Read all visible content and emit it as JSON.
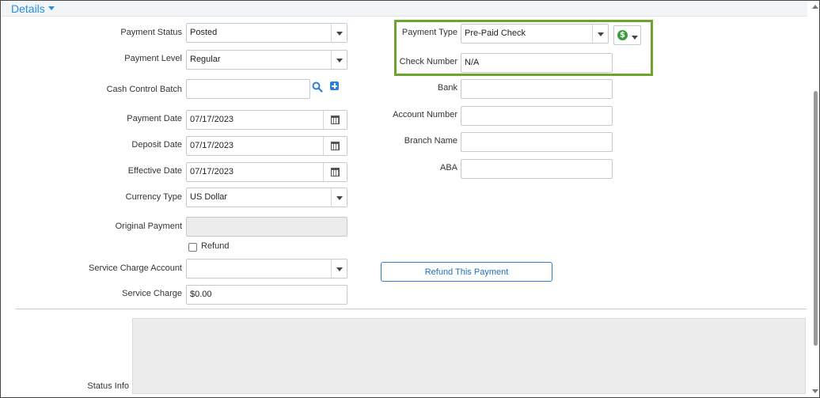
{
  "header": {
    "title": "Details"
  },
  "left": {
    "payment_status": {
      "label": "Payment Status",
      "value": "Posted"
    },
    "payment_level": {
      "label": "Payment Level",
      "value": "Regular"
    },
    "cash_control_batch": {
      "label": "Cash Control Batch",
      "value": ""
    },
    "payment_date": {
      "label": "Payment Date",
      "value": "07/17/2023"
    },
    "deposit_date": {
      "label": "Deposit Date",
      "value": "07/17/2023"
    },
    "effective_date": {
      "label": "Effective Date",
      "value": "07/17/2023"
    },
    "currency_type": {
      "label": "Currency Type",
      "value": "US Dollar"
    },
    "original_payment": {
      "label": "Original Payment",
      "value": ""
    },
    "refund": {
      "label": "Refund",
      "checked": false
    },
    "service_charge_account": {
      "label": "Service Charge Account",
      "value": ""
    },
    "service_charge": {
      "label": "Service Charge",
      "value": "$0.00"
    }
  },
  "right": {
    "payment_type": {
      "label": "Payment Type",
      "value": "Pre-Paid Check"
    },
    "check_number": {
      "label": "Check Number",
      "value": "N/A"
    },
    "bank": {
      "label": "Bank",
      "value": ""
    },
    "account_number": {
      "label": "Account Number",
      "value": ""
    },
    "branch_name": {
      "label": "Branch Name",
      "value": ""
    },
    "aba": {
      "label": "ABA",
      "value": ""
    }
  },
  "buttons": {
    "refund_this_payment": "Refund This Payment"
  },
  "status_info": {
    "label": "Status Info",
    "value": ""
  },
  "colors": {
    "accent": "#2a8fd8",
    "highlight_border": "#6ea32e",
    "dollar_icon": "#3a9d3a"
  },
  "icons": [
    "chevron-down-icon",
    "search-icon",
    "plus-icon",
    "calendar-icon",
    "dollar-icon"
  ]
}
